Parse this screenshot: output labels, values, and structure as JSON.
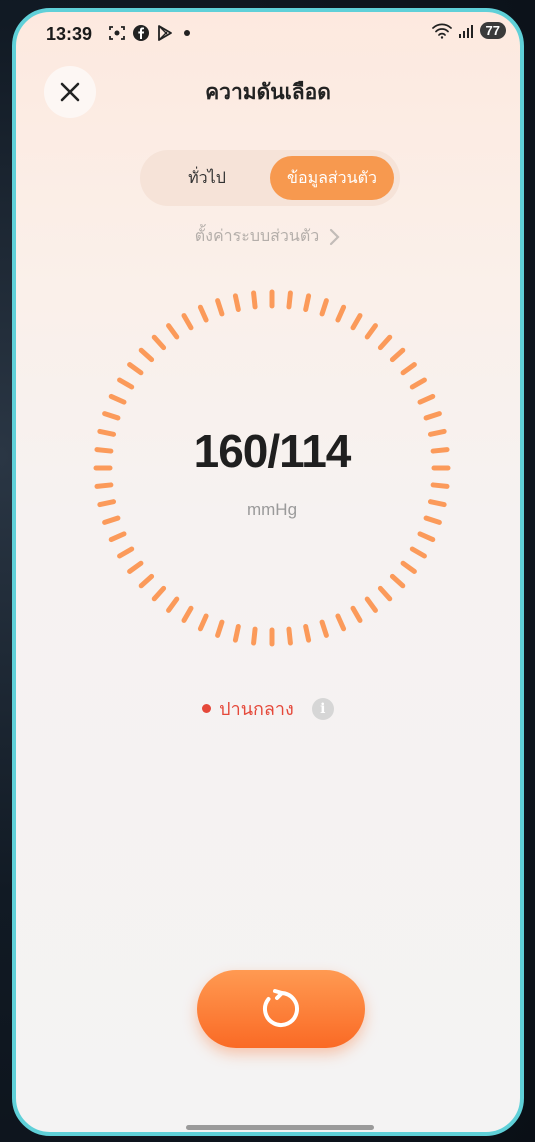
{
  "status_bar": {
    "time": "13:39",
    "battery": "77"
  },
  "header": {
    "title": "ความดันเลือด"
  },
  "tabs": [
    {
      "label": "ทั่วไป",
      "selected": false
    },
    {
      "label": "ข้อมูลส่วนตัว",
      "selected": true
    }
  ],
  "settings_link": {
    "label": "ตั้งค่าระบบส่วนตัว"
  },
  "reading": {
    "value": "160/114",
    "unit": "mmHg"
  },
  "status": {
    "label": "ปานกลาง",
    "color": "#e5483a"
  },
  "icons": {
    "close": "close-icon",
    "chevron": "chevron-right-icon",
    "info": "info-icon",
    "refresh": "refresh-icon"
  },
  "colors": {
    "accent": "#f7994f",
    "gauge_tick": "#fb9a5a",
    "button": "#fa6a25"
  }
}
